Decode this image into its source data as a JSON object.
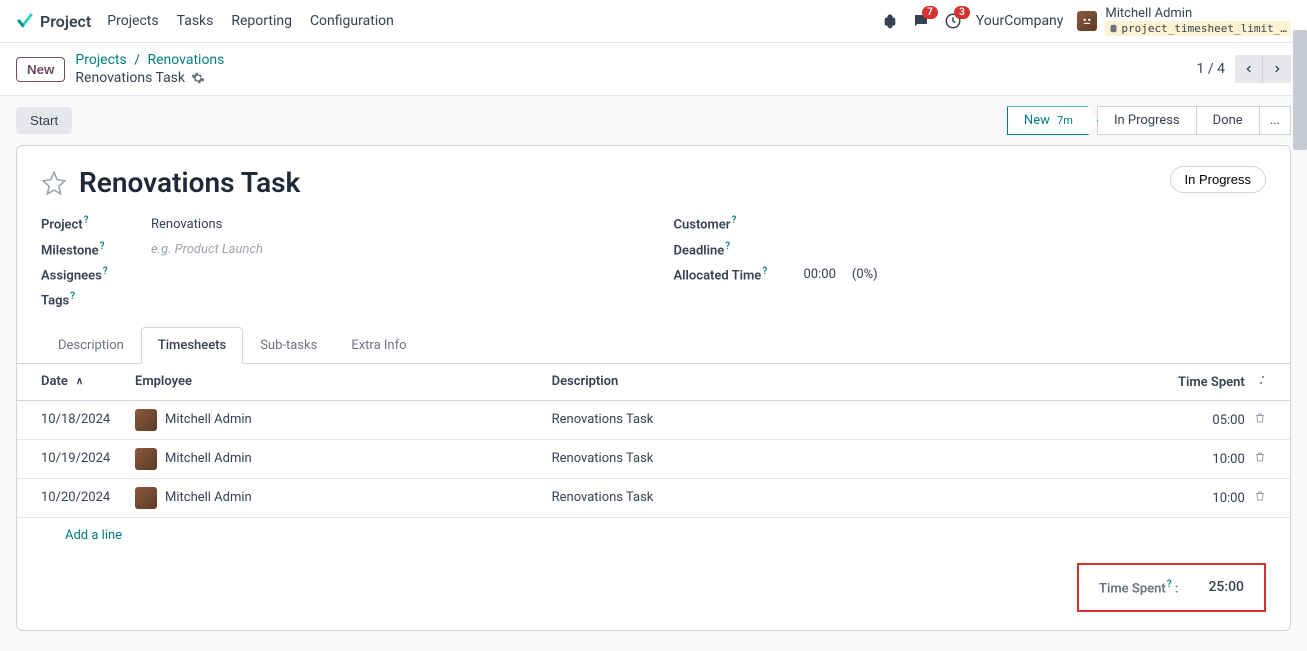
{
  "nav": {
    "brand": "Project",
    "menu": [
      "Projects",
      "Tasks",
      "Reporting",
      "Configuration"
    ],
    "msg_badge": "7",
    "activity_badge": "3",
    "company": "YourCompany",
    "user_name": "Mitchell Admin",
    "code_tag": "project_timesheet_limit_…"
  },
  "breadcrumb": {
    "new_btn": "New",
    "crumb1": "Projects",
    "crumb2": "Renovations",
    "current": "Renovations Task",
    "pager": "1 / 4"
  },
  "status_bar": {
    "start": "Start",
    "stages": {
      "new": "New",
      "new_duration": "7m",
      "in_progress": "In Progress",
      "done": "Done",
      "more": "..."
    }
  },
  "task": {
    "title": "Renovations Task",
    "in_progress_btn": "In Progress",
    "labels": {
      "project": "Project",
      "milestone": "Milestone",
      "assignees": "Assignees",
      "tags": "Tags",
      "customer": "Customer",
      "deadline": "Deadline",
      "allocated": "Allocated Time"
    },
    "values": {
      "project": "Renovations",
      "milestone_placeholder": "e.g. Product Launch",
      "allocated_time": "00:00",
      "allocated_pct": "(0%)"
    }
  },
  "tabs": [
    "Description",
    "Timesheets",
    "Sub-tasks",
    "Extra Info"
  ],
  "table": {
    "headers": {
      "date": "Date",
      "employee": "Employee",
      "description": "Description",
      "time_spent": "Time Spent"
    },
    "rows": [
      {
        "date": "10/18/2024",
        "employee": "Mitchell Admin",
        "description": "Renovations Task",
        "time": "05:00"
      },
      {
        "date": "10/19/2024",
        "employee": "Mitchell Admin",
        "description": "Renovations Task",
        "time": "10:00"
      },
      {
        "date": "10/20/2024",
        "employee": "Mitchell Admin",
        "description": "Renovations Task",
        "time": "10:00"
      }
    ],
    "add_line": "Add a line"
  },
  "totals": {
    "label": "Time Spent",
    "colon": ":",
    "value": "25:00"
  }
}
